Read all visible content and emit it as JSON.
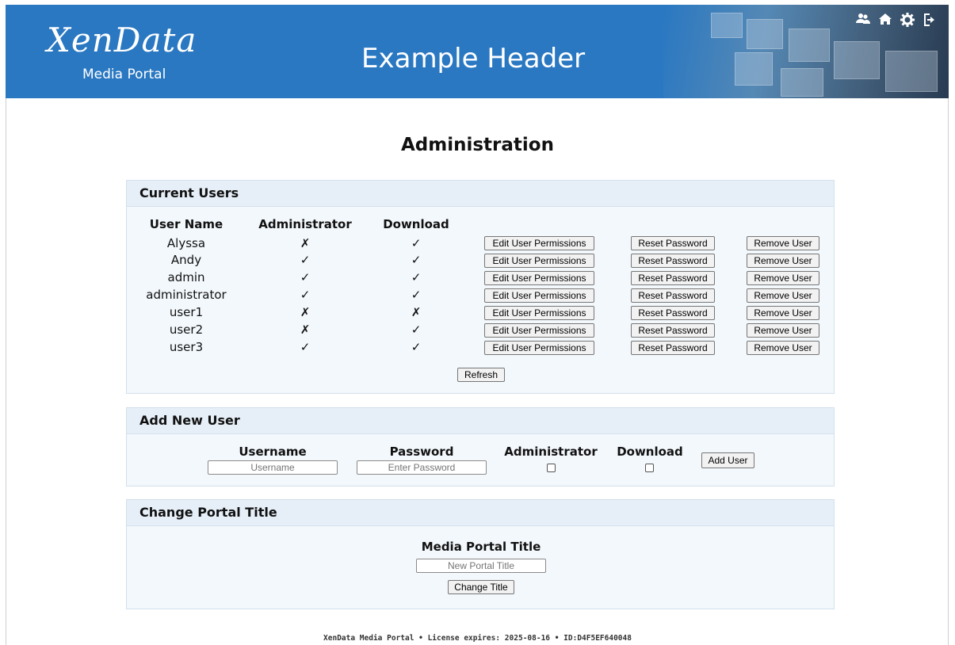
{
  "header": {
    "logo_text": "XenData",
    "logo_sub": "Media Portal",
    "title": "Example Header",
    "icons": [
      "users-icon",
      "home-icon",
      "gear-icon",
      "logout-icon"
    ]
  },
  "page_title": "Administration",
  "current_users": {
    "heading": "Current Users",
    "columns": [
      "User Name",
      "Administrator",
      "Download"
    ],
    "rows": [
      {
        "name": "Alyssa",
        "admin": "✗",
        "download": "✓"
      },
      {
        "name": "Andy",
        "admin": "✓",
        "download": "✓"
      },
      {
        "name": "admin",
        "admin": "✓",
        "download": "✓"
      },
      {
        "name": "administrator",
        "admin": "✓",
        "download": "✓"
      },
      {
        "name": "user1",
        "admin": "✗",
        "download": "✗"
      },
      {
        "name": "user2",
        "admin": "✗",
        "download": "✓"
      },
      {
        "name": "user3",
        "admin": "✓",
        "download": "✓"
      }
    ],
    "row_actions": {
      "edit": "Edit User Permissions",
      "reset": "Reset Password",
      "remove": "Remove User"
    },
    "refresh": "Refresh"
  },
  "add_user": {
    "heading": "Add New User",
    "username_label": "Username",
    "username_placeholder": "Username",
    "password_label": "Password",
    "password_placeholder": "Enter Password",
    "admin_label": "Administrator",
    "download_label": "Download",
    "add_button": "Add User"
  },
  "portal_title": {
    "heading": "Change Portal Title",
    "label": "Media Portal Title",
    "placeholder": "New Portal Title",
    "button": "Change Title"
  },
  "footer": "XenData Media Portal • License expires: 2025-08-16 • ID:D4F5EF640048"
}
